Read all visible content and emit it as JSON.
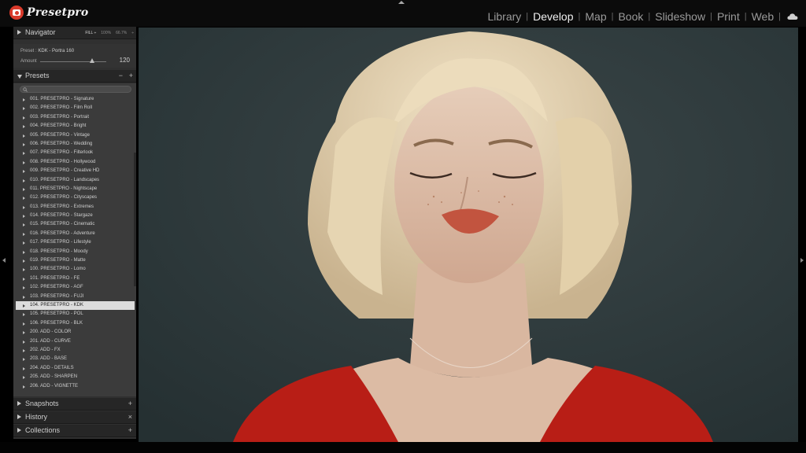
{
  "app": {
    "logo_text": "Presetpro",
    "modules": [
      "Library",
      "Develop",
      "Map",
      "Book",
      "Slideshow",
      "Print",
      "Web"
    ],
    "active_module": "Develop"
  },
  "navigator": {
    "title": "Navigator",
    "zoom_options": [
      "FILL ÷",
      "100%",
      "66.7%",
      "÷"
    ]
  },
  "preset_info": {
    "preset_label": "Preset :",
    "preset_value": "KDK - Portra 160",
    "amount_label": "Amount",
    "amount_value": "120"
  },
  "presets": {
    "title": "Presets",
    "minus": "−",
    "plus": "+",
    "selected_index": 23,
    "items": [
      "001. PRESETPRO - Signature",
      "002. PRESETPRO - Film Roll",
      "003. PRESETPRO - Portrait",
      "004. PRESETPRO - Bright",
      "005. PRESETPRO - Vintage",
      "006. PRESETPRO - Wedding",
      "007. PRESETPRO - Filterlook",
      "008. PRESETPRO - Hollywood",
      "009. PRESETPRO - Creative HD",
      "010. PRESETPRO - Landscapes",
      "011. PRESETPRO - Nightscape",
      "012. PRESETPRO - Cityscapes",
      "013. PRESETPRO - Extremes",
      "014. PRESETPRO - Stargaze",
      "015. PRESETPRO - Cinematic",
      "016. PRESETPRO - Adventure",
      "017. PRESETPRO - Lifestyle",
      "018. PRESETPRO - Moody",
      "019. PRESETPRO - Matte",
      "100. PRESETPRO - Lomo",
      "101. PRESETPRO - FE",
      "102. PRESETPRO - AGF",
      "103. PRESETPRO - FUJI",
      "104. PRESETPRO - KDK",
      "105. PRESETPRO - POL",
      "106. PRESETPRO - BLK",
      "200. ADD - COLOR",
      "201. ADD - CURVE",
      "202. ADD - FX",
      "203. ADD - BASE",
      "204. ADD - DETAILS",
      "205. ADD - SHARPEN",
      "206. ADD - VIGNETTE"
    ]
  },
  "snapshots": {
    "title": "Snapshots",
    "action": "+"
  },
  "history": {
    "title": "History",
    "action": "×"
  },
  "collections": {
    "title": "Collections",
    "action": "+"
  },
  "colors": {
    "logo_red": "#d93a2b",
    "panel_bg": "#3b3b3b",
    "selected_row": "#dcdcdc",
    "photo_background": "#2d393b",
    "dress_red": "#b81e16"
  }
}
